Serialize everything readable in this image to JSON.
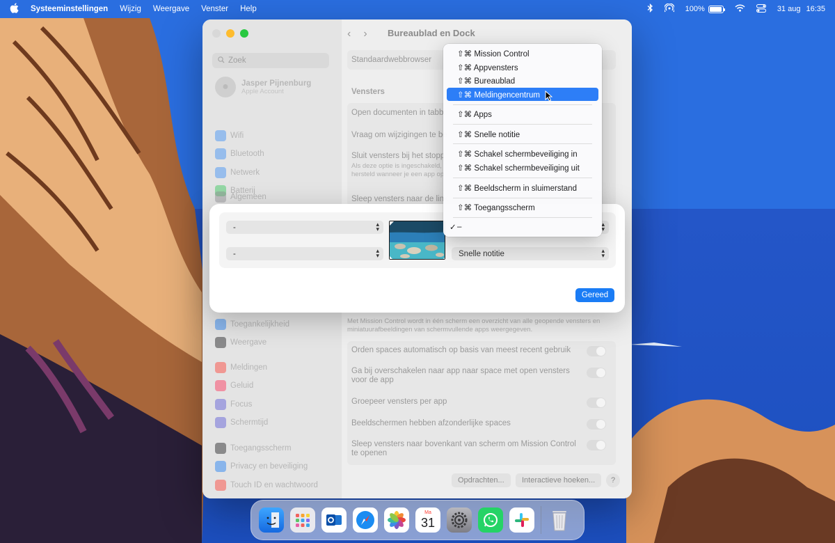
{
  "menubar": {
    "app_name": "Systeeminstellingen",
    "items": [
      "Wijzig",
      "Weergave",
      "Venster",
      "Help"
    ],
    "battery": "100%",
    "date": "31 aug",
    "time": "16:35"
  },
  "window": {
    "title": "Bureaublad en Dock",
    "search_placeholder": "Zoek",
    "user": {
      "name": "Jasper Pijnenburg",
      "subtitle": "Apple Account"
    },
    "sidebar_group1": [
      "Wifi",
      "Bluetooth",
      "Netwerk",
      "Batterij"
    ],
    "sidebar_group2": [
      "Algemeen"
    ],
    "sidebar_group3": [
      "Toegankelijkheid",
      "Weergave"
    ],
    "sidebar_group4": [
      "Meldingen",
      "Geluid",
      "Focus",
      "Schermtijd"
    ],
    "sidebar_group5": [
      "Toegangsscherm",
      "Privacy en beveiliging",
      "Touch ID en wachtwoord"
    ],
    "main": {
      "default_browser": "Standaardwebbrowser",
      "section_windows": "Vensters",
      "open_docs": "Open documenten in tabbl",
      "ask_changes": "Vraag om wijzigingen te be",
      "close_windows": "Sluit vensters bij het stopp",
      "close_windows_desc1": "Als deze optie is ingeschakeld,",
      "close_windows_desc2": "hersteld wanneer je een app op",
      "drag_windows": "Sleep vensters naar de link",
      "mc_desc1": "Met Mission Control wordt in één scherm een overzicht van alle geopende vensters en",
      "mc_desc2": "miniatuurafbeeldingen van schermvullende apps weergegeven.",
      "rows": [
        "Orden spaces automatisch op basis van meest recent gebruik",
        "Ga bij overschakelen naar app naar space met open vensters voor de app",
        "Groepeer vensters per app",
        "Beeldschermen hebben afzonderlijke spaces",
        "Sleep vensters naar bovenkant van scherm om Mission Control te openen"
      ],
      "btn_shortcuts": "Opdrachten...",
      "btn_hot_corners": "Interactieve hoeken...",
      "btn_help": "?"
    }
  },
  "dialog": {
    "top_left": "-",
    "bottom_left": "-",
    "bottom_right": "Snelle notitie",
    "done": "Gereed"
  },
  "dropdown": {
    "items": [
      "⇧⌘ Mission Control",
      "⇧⌘ Appvensters",
      "⇧⌘ Bureaublad",
      "⇧⌘ Meldingencentrum",
      "⇧⌘ Apps",
      "⇧⌘ Snelle notitie",
      "⇧⌘ Schakel schermbeveiliging in",
      "⇧⌘ Schakel schermbeveiliging uit",
      "⇧⌘ Beeldscherm in sluimerstand",
      "⇧⌘ Toegangsscherm",
      "–"
    ],
    "check_mark": "✓",
    "selected_index": 3
  },
  "dock": {
    "calendar_month": "Ma",
    "calendar_day": "31"
  }
}
